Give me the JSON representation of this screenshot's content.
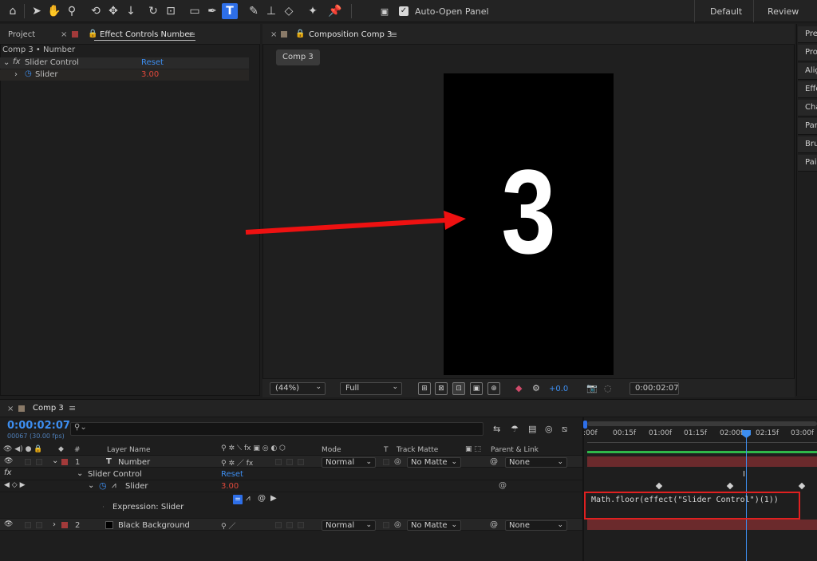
{
  "toolbar": {
    "auto_open_label": "Auto-Open Panel",
    "auto_open_checked": true,
    "workspace_default": "Default",
    "workspace_review": "Review",
    "active_tool": "T"
  },
  "left_panel": {
    "tab_project": "Project",
    "tab_effect_controls": "Effect Controls Number",
    "breadcrumb": "Comp 3 • Number",
    "effect_name": "Slider Control",
    "effect_reset": "Reset",
    "param_name": "Slider",
    "param_value": "3.00"
  },
  "viewer": {
    "tab_title": "Composition Comp 3",
    "comp_chip": "Comp 3",
    "displayed_number": "3",
    "zoom": "(44%)",
    "resolution": "Full",
    "exposure": "+0.0",
    "timecode": "0:00:02:07"
  },
  "side_tabs": [
    "Pre",
    "Pro",
    "Alig",
    "Effe",
    "Cha",
    "Par",
    "Bru",
    "Pair"
  ],
  "timeline": {
    "tab_title": "Comp 3",
    "timecode": "0:00:02:07",
    "frame_info": "00067 (30.00 fps)",
    "search_placeholder": "",
    "columns": {
      "num": "#",
      "layer_name": "Layer Name",
      "mode": "Mode",
      "t": "T",
      "track_matte": "Track Matte",
      "parent": "Parent & Link"
    },
    "ruler": [
      ":00f",
      "00:15f",
      "01:00f",
      "01:15f",
      "02:00f",
      "02:15f",
      "03:00f"
    ],
    "layers": [
      {
        "num": "1",
        "type_icon": "T",
        "name": "Number",
        "mode": "Normal",
        "matte": "No Matte",
        "parent": "None",
        "label_color": "#a33a3a"
      },
      {
        "num": "2",
        "type_icon": "",
        "name": "Black Background",
        "mode": "Normal",
        "matte": "No Matte",
        "parent": "None",
        "label_color": "#a33a3a"
      }
    ],
    "effect_row": {
      "name": "Slider Control",
      "reset": "Reset"
    },
    "slider_row": {
      "name": "Slider",
      "value": "3.00"
    },
    "expression_row": {
      "label": "Expression: Slider"
    },
    "expression_code": "Math.floor(effect(\"Slider Control\")(1))"
  },
  "colors": {
    "accent_blue": "#2e6fe8",
    "timecode_blue": "#3d8ef0",
    "value_red": "#e0483b",
    "layer_bar": "#6b2a2c",
    "highlight_box": "#e02020",
    "arrow": "#ee1111"
  }
}
